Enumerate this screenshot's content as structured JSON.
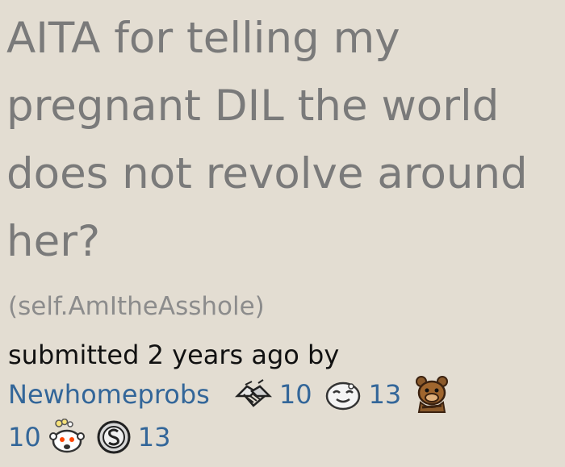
{
  "post": {
    "title": "AITA for telling my pregnant DIL the world does not revolve around her?",
    "domain": "(self.AmItheAsshole)",
    "tagline": "submitted 2 years ago by",
    "author": "Newhomeprobs"
  },
  "awards": [
    {
      "icon": "handshake-award-icon",
      "count": "10"
    },
    {
      "icon": "smiling-face-award-icon",
      "count": "13"
    },
    {
      "icon": "bear-award-icon",
      "count": ""
    },
    {
      "icon": "popcorn-snoo-award-icon",
      "count": "10"
    },
    {
      "icon": "silver-coin-award-icon",
      "count": "13"
    }
  ],
  "colors": {
    "background": "#e3ddd2",
    "title": "#7a7a7a",
    "domain": "#8c8c8c",
    "tagline": "#111111",
    "link": "#336699"
  }
}
